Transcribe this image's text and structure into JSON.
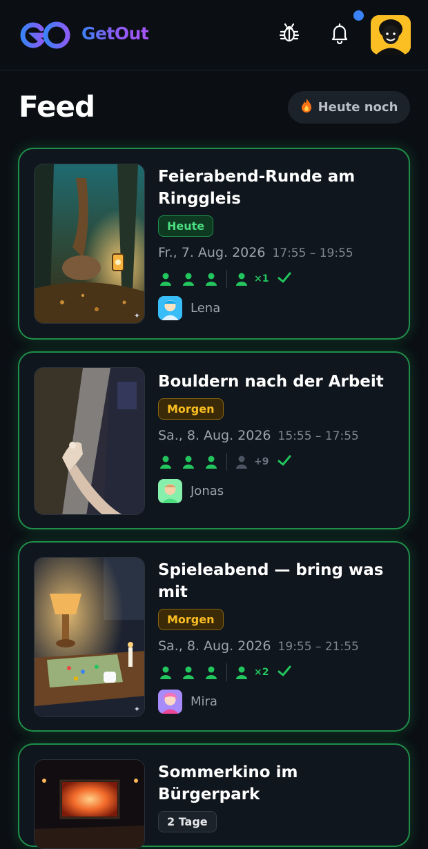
{
  "app": {
    "name": "GetOut"
  },
  "header": {
    "logo_icon": "infinity-logo-icon",
    "bug_icon": "bug-icon",
    "bell_icon": "bell-icon",
    "has_notification": true,
    "avatar_icon": "user-avatar-icon"
  },
  "page": {
    "title": "Feed",
    "filter_label": "Heute noch",
    "filter_icon": "flame-icon"
  },
  "colors": {
    "accent_green": "#22c55e",
    "today_badge": "#4ade80",
    "tomorrow_badge": "#fbbf24",
    "brand_blue": "#3b82f6",
    "brand_purple": "#8b5cf6"
  },
  "events": [
    {
      "title": "Feierabend-Runde am Ringgleis",
      "badge": "Heute",
      "badge_type": "today",
      "date": "Fr., 7. Aug. 2026",
      "time": "17:55 – 19:55",
      "extra_label": "×1",
      "extra_active": true,
      "host": "Lena",
      "thumb_icon": "lantern-forest-image"
    },
    {
      "title": "Bouldern nach der Arbeit",
      "badge": "Morgen",
      "badge_type": "tomorrow",
      "date": "Sa., 8. Aug. 2026",
      "time": "15:55 – 17:55",
      "extra_label": "+9",
      "extra_active": false,
      "host": "Jonas",
      "thumb_icon": "climbing-wall-image"
    },
    {
      "title": "Spieleabend — bring was mit",
      "badge": "Morgen",
      "badge_type": "tomorrow",
      "date": "Sa., 8. Aug. 2026",
      "time": "19:55 – 21:55",
      "extra_label": "×2",
      "extra_active": true,
      "host": "Mira",
      "thumb_icon": "board-game-table-image"
    },
    {
      "title": "Sommerkino im Bürgerpark",
      "badge": "2 Tage",
      "badge_type": "days",
      "thumb_icon": "outdoor-cinema-image"
    }
  ]
}
